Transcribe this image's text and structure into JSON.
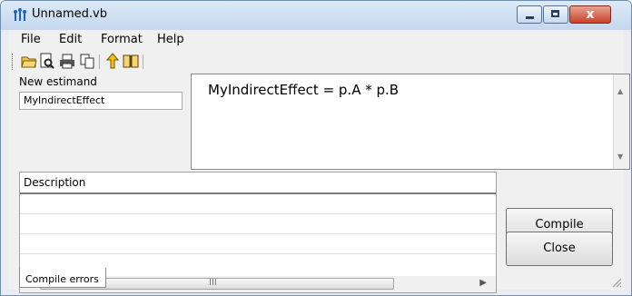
{
  "window": {
    "title": "Unnamed.vb",
    "close_glyph": "x"
  },
  "menu": [
    "File",
    "Edit",
    "Format",
    "Help"
  ],
  "toolbar": {
    "buttons": [
      "open-folder-icon",
      "print-preview-icon",
      "print-icon",
      "copy-icon",
      "arrow-up-icon",
      "book-icon"
    ]
  },
  "estimand": {
    "label": "New estimand",
    "value": "MyIndirectEffect"
  },
  "editor": {
    "text": "MyIndirectEffect = p.A * p.B"
  },
  "grid": {
    "header": "Description",
    "scroll_grip": "III"
  },
  "tabs": {
    "compile_errors": "Compile errors"
  },
  "buttons": {
    "compile": "Compile",
    "close": "Close"
  },
  "colors": {
    "titlebar": "#c4d8ee",
    "close_button": "#c7432b"
  }
}
